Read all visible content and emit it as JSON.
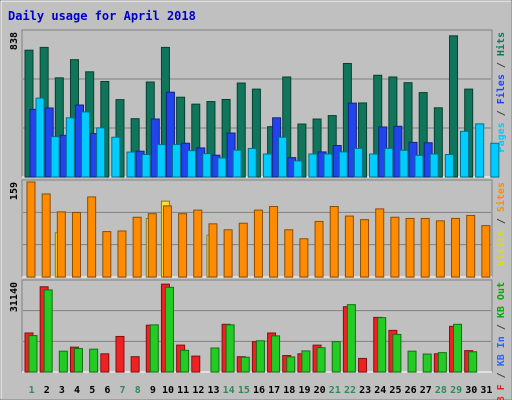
{
  "chart_data": {
    "type": "bar",
    "title": "Daily usage for April 2018",
    "categories": [
      "1",
      "2",
      "3",
      "4",
      "5",
      "6",
      "7",
      "8",
      "9",
      "10",
      "11",
      "12",
      "13",
      "14",
      "15",
      "16",
      "17",
      "18",
      "19",
      "20",
      "21",
      "22",
      "23",
      "24",
      "25",
      "26",
      "27",
      "28",
      "29",
      "30",
      "31"
    ],
    "weekend_days": [
      "1",
      "7",
      "8",
      "14",
      "15",
      "21",
      "22",
      "28",
      "29"
    ],
    "panels": [
      {
        "id": "top",
        "max_label": "838",
        "ylim": [
          0,
          838
        ],
        "axis_label_parts": [
          {
            "text": "Pages",
            "color": "#00CCFF"
          },
          {
            "text": " / ",
            "color": "#444444"
          },
          {
            "text": "Files",
            "color": "#2244FF"
          },
          {
            "text": " / ",
            "color": "#444444"
          },
          {
            "text": "Hits",
            "color": "#0C7A5A"
          }
        ],
        "series": [
          {
            "name": "Hits",
            "color": "#10755A",
            "values": [
              733,
              749,
              573,
              678,
              608,
              552,
              447,
              337,
              549,
              749,
              461,
              421,
              436,
              448,
              543,
              508,
              291,
              578,
              306,
              335,
              355,
              656,
              428,
              588,
              578,
              545,
              488,
              400,
              816,
              508,
              0
            ]
          },
          {
            "name": "Files",
            "color": "#2244EE",
            "values": [
              391,
              399,
              241,
              416,
              251,
              0,
              0,
              149,
              335,
              490,
              195,
              168,
              126,
              254,
              0,
              0,
              342,
              112,
              0,
              145,
              182,
              427,
              0,
              289,
              293,
              200,
              198,
              0,
              0,
              0,
              0
            ]
          },
          {
            "name": "Pages",
            "color": "#00CCFF",
            "values": [
              456,
              233,
              342,
              376,
              284,
              230,
              144,
              130,
              187,
              188,
              152,
              135,
              110,
              155,
              165,
              133,
              230,
              93,
              133,
              133,
              145,
              165,
              133,
              165,
              154,
              125,
              133,
              130,
              264,
              307,
              195
            ]
          }
        ]
      },
      {
        "id": "mid",
        "max_label": "159",
        "ylim": [
          0,
          159
        ],
        "axis_label_parts": [
          {
            "text": "Visits",
            "color": "#DDDD00"
          },
          {
            "text": " / ",
            "color": "#444444"
          },
          {
            "text": "Sites",
            "color": "#FF8C00"
          }
        ],
        "series": [
          {
            "name": "Visits",
            "color": "#FFDD33",
            "values": [
              0,
              0,
              74,
              0,
              0,
              0,
              0,
              0,
              98,
              127,
              0,
              0,
              70,
              0,
              0,
              0,
              0,
              0,
              0,
              0,
              0,
              0,
              0,
              0,
              0,
              0,
              0,
              0,
              0,
              0,
              0
            ]
          },
          {
            "name": "Sites",
            "color": "#FF8C00",
            "values": [
              159,
              139,
              109,
              108,
              134,
              76,
              77,
              100,
              106,
              119,
              106,
              112,
              89,
              79,
              90,
              112,
              118,
              79,
              64,
              93,
              118,
              102,
              96,
              114,
              100,
              98,
              98,
              94,
              98,
              103,
              86
            ]
          }
        ]
      },
      {
        "id": "bot",
        "max_label": "31140",
        "ylim": [
          0,
          31140
        ],
        "axis_label_parts": [
          {
            "text": "KB F",
            "color": "#EE2222"
          },
          {
            "text": " / ",
            "color": "#444444"
          },
          {
            "text": "KB In",
            "color": "#2266FF"
          },
          {
            "text": " / ",
            "color": "#444444"
          },
          {
            "text": "KB Out",
            "color": "#00AA00"
          }
        ],
        "series": [
          {
            "name": "KB F",
            "color": "#EE2222",
            "values": [
              13500,
              29500,
              0,
              8600,
              0,
              6300,
              12300,
              5300,
              16200,
              30400,
              9300,
              5500,
              0,
              16500,
              5300,
              10500,
              13500,
              5700,
              6300,
              9300,
              0,
              22600,
              4700,
              18900,
              14400,
              0,
              0,
              6300,
              15800,
              7400,
              0
            ]
          },
          {
            "name": "KB Out",
            "color": "#22CC22",
            "values": [
              12600,
              28400,
              7200,
              8100,
              7900,
              0,
              0,
              0,
              16300,
              29300,
              7500,
              0,
              8300,
              16300,
              5100,
              10800,
              12500,
              5200,
              7300,
              8400,
              10500,
              23300,
              0,
              18800,
              13000,
              7200,
              6200,
              6700,
              16500,
              7000,
              0
            ]
          }
        ]
      }
    ]
  }
}
